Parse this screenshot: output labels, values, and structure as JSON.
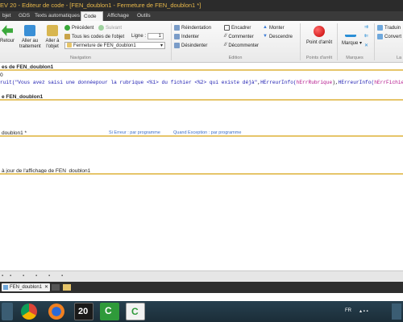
{
  "title": "EV 20 - Editeur de code - [FEN_doublon1 - Fermeture de FEN_doublon1 *]",
  "menu_tabs": [
    "bjet",
    "GDS",
    "Texts automatiques",
    "Code",
    "Affichage",
    "Outils"
  ],
  "active_tab": "Code",
  "ribbon": {
    "retour": "Retour",
    "aller_traitement": "Aller au traitement",
    "aller_objet": "Aller à l'objet",
    "precedent": "Précédent",
    "suivant": "Suivant",
    "tous_codes": "Tous les codes de l'objet",
    "ligne_label": "Ligne :",
    "ligne_value": "1",
    "combo_value": "Fermeture de FEN_doublon1",
    "navigation": "Navigation",
    "reindentation": "Réindentation",
    "indenter": "Indenter",
    "desindenter": "Désindenter",
    "encadrer": "Encadrer",
    "commenter": "Commenter",
    "decommenter": "Décommenter",
    "monter": "Monter",
    "descendre": "Descendre",
    "edition": "Edition",
    "point_arret": "Point d'arrêt",
    "points_arret": "Points d'arrêt",
    "marque": "Marque",
    "marques": "Marques",
    "traduire": "Traduin",
    "convertir": "Convert",
    "la": "La"
  },
  "editor": {
    "sec1_header": "es de FEN_doublon1",
    "sec1_line1": "O",
    "sec1_code_kw": "ruit(",
    "sec1_code_str": "\"Vous avez saisi une donnéepour la rubrique <%1> du fichier <%2> qui existe déjà\"",
    "sec1_code_mid1": ",",
    "sec1_code_fn1": "HErreurInfo(",
    "sec1_code_arg1": "hErrRubrique",
    "sec1_code_mid2": "),",
    "sec1_code_fn2": "HErreurInfo(",
    "sec1_code_arg2": "hErrFichier",
    "sec1_code_end": "))",
    "sec2_header": "e FEN_doublon1",
    "sec3_header": "doublon1 *",
    "si_erreur": "Si Erreur : par programme",
    "quand_exception": "Quand Exception : par programme",
    "sec4_header": "à jour de l'affichage de FEN_doublon1"
  },
  "doc_tab": "FEN_doublon1",
  "taskbar": {
    "lang": "FR",
    "app20": "20"
  },
  "colors": {
    "accent": "#e6c56a",
    "title_text": "#e8b84a",
    "keyword": "#1a1ab0",
    "param": "#b2128a"
  }
}
